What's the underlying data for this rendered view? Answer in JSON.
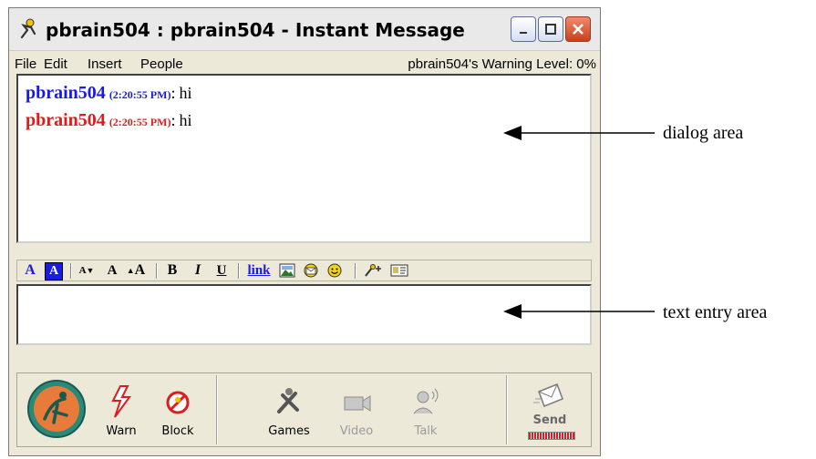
{
  "window": {
    "title": "pbrain504 : pbrain504 - Instant Message",
    "controls": {
      "minimize": "_",
      "maximize": "□",
      "close": "✕"
    }
  },
  "menu": {
    "file": "File",
    "edit": "Edit",
    "insert": "Insert",
    "people": "People",
    "warning_level": "pbrain504's Warning Level: 0%"
  },
  "dialog": {
    "messages": [
      {
        "name": "pbrain504",
        "time": "(2:20:55 PM)",
        "separator": ":",
        "text": "hi",
        "color": "#1a1ae6"
      },
      {
        "name": "pbrain504",
        "time": "(2:20:55 PM)",
        "separator": ":",
        "text": "hi",
        "color": "#e01b1b"
      }
    ]
  },
  "format_toolbar": {
    "text_color": "A",
    "back_color": "A",
    "smaller_font": "A",
    "normal_font": "A",
    "larger_font": "A",
    "bold": "B",
    "italic": "I",
    "underline": "U",
    "link": "link"
  },
  "entry": {
    "value": ""
  },
  "bottom_toolbar": {
    "warn": "Warn",
    "block": "Block",
    "games": "Games",
    "video": "Video",
    "talk": "Talk",
    "send": "Send"
  },
  "annotations": {
    "dialog_area": "dialog area",
    "text_entry_area": "text entry area"
  }
}
